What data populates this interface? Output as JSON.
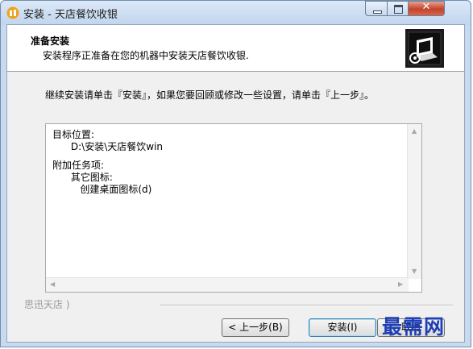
{
  "window": {
    "title": "安装 - 天店餐饮收银",
    "close_label": "✕"
  },
  "header": {
    "title": "准备安装",
    "subtitle": "安装程序正准备在您的机器中安装天店餐饮收银."
  },
  "body": {
    "intro": "继续安装请单击『安装』，如果您要回顾或修改一些设置，请单击『上一步』。",
    "memo_lines": [
      "目标位置:",
      "      D:\\安装\\天店餐饮win",
      "",
      "附加任务项:",
      "      其它图标:",
      "         创建桌面图标(d)"
    ],
    "scroll_up": "▲",
    "scroll_down": "▼",
    "scroll_left": "◀",
    "scroll_right": "▶"
  },
  "footer": {
    "brand": "思迅天店                )",
    "back_button": "< 上一步(B)",
    "install_button": "安装(I)",
    "cancel_button": "取消"
  },
  "watermark": "最需网",
  "colors": {
    "title_bar": "#c1d5ee",
    "close_button": "#c3432b",
    "watermark": "#1f3eb3"
  }
}
